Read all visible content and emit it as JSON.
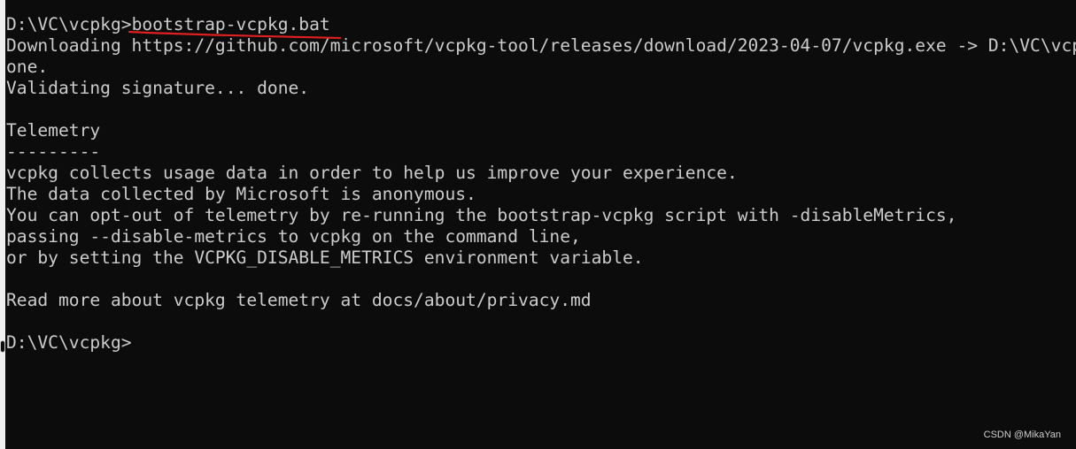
{
  "console": {
    "command_prompt": "D:\\VC\\vcpkg>",
    "command_text": "bootstrap-vcpkg.bat",
    "output_lines": [
      "Downloading https://github.com/microsoft/vcpkg-tool/releases/download/2023-04-07/vcpkg.exe -> D:\\VC\\vcpkg\\vcpkg.exe... d",
      "one.",
      "Validating signature... done.",
      "",
      "Telemetry",
      "---------",
      "vcpkg collects usage data in order to help us improve your experience.",
      "The data collected by Microsoft is anonymous.",
      "You can opt-out of telemetry by re-running the bootstrap-vcpkg script with -disableMetrics,",
      "passing --disable-metrics to vcpkg on the command line,",
      "or by setting the VCPKG_DISABLE_METRICS environment variable.",
      "",
      "Read more about vcpkg telemetry at docs/about/privacy.md",
      ""
    ],
    "final_prompt": "D:\\VC\\vcpkg>"
  },
  "annotation": {
    "underline_color": "#e02020"
  },
  "watermark": "CSDN @MikaYan"
}
